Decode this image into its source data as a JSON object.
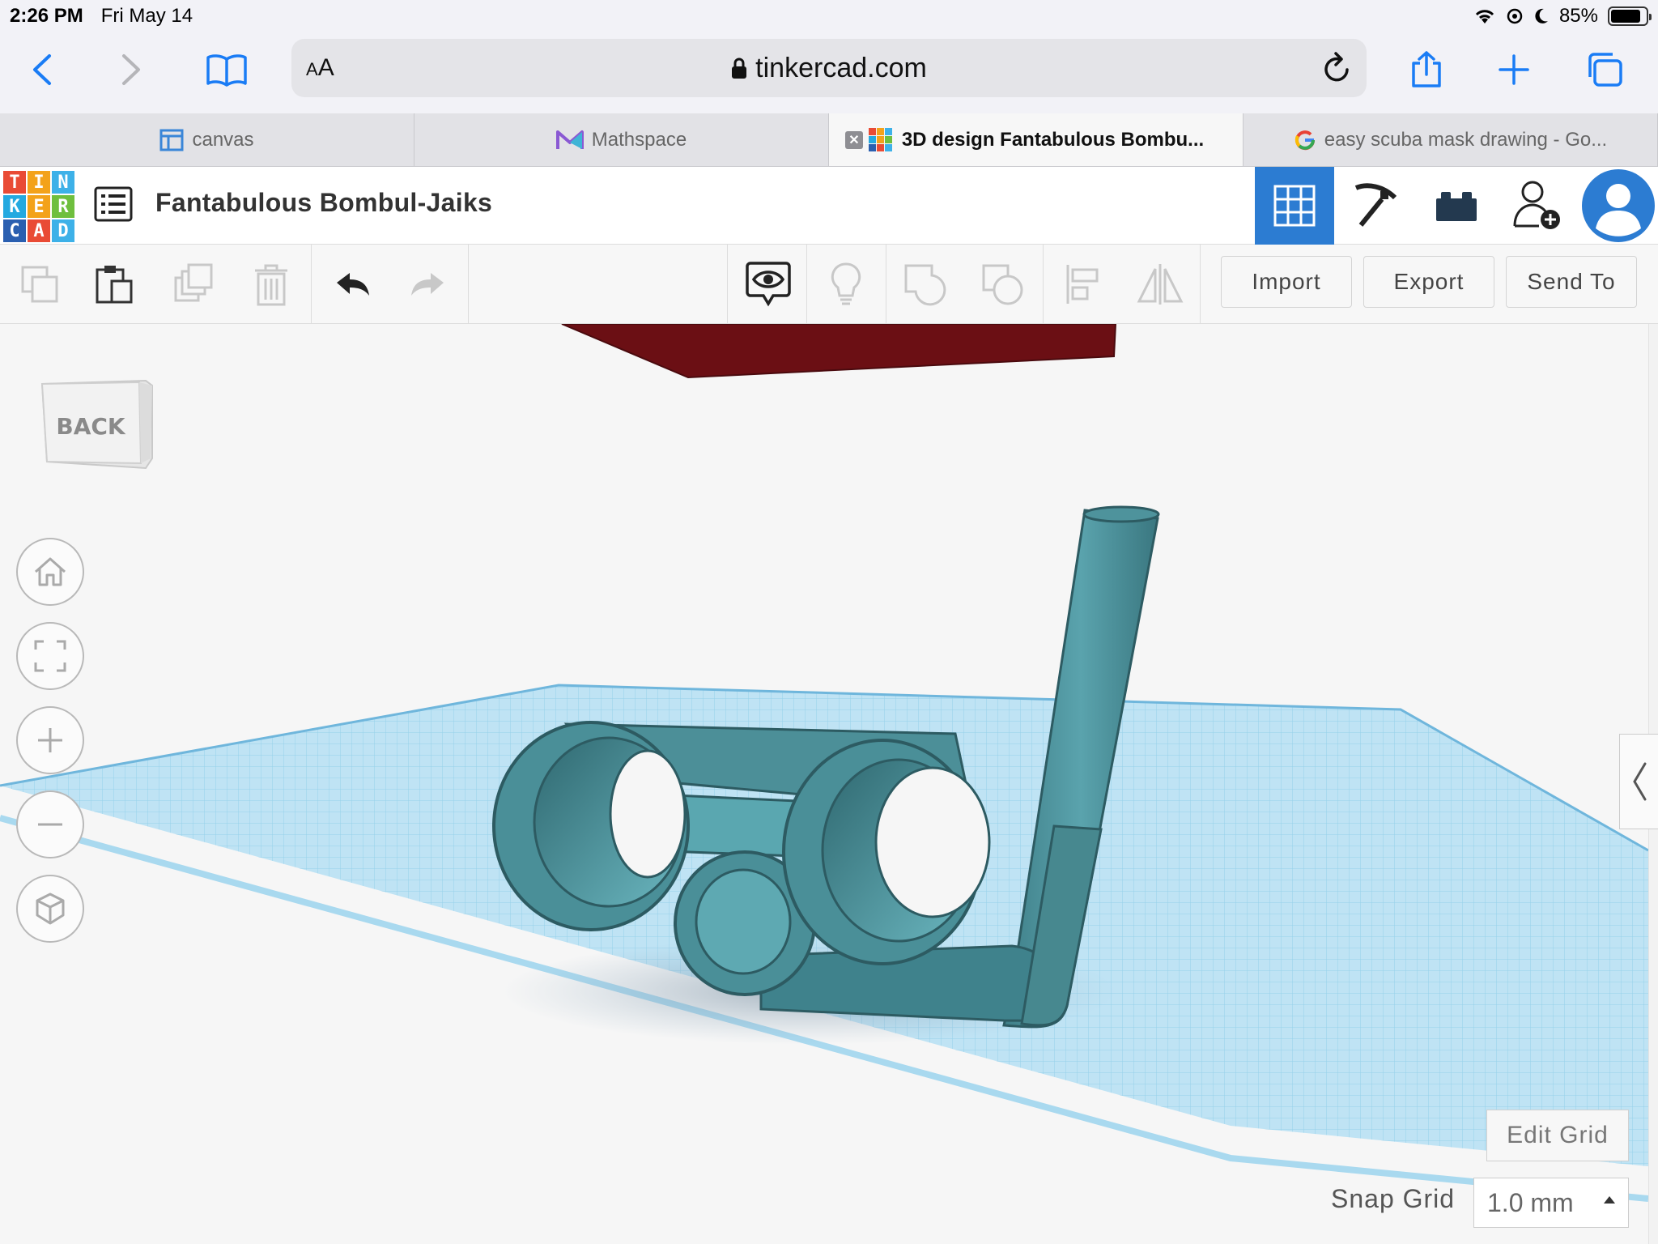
{
  "status": {
    "time": "2:26 PM",
    "date": "Fri May 14",
    "battery": "85%",
    "battery_level": 0.85
  },
  "browser": {
    "text_size_label_small": "A",
    "text_size_label_large": "A",
    "url": "tinkercad.com",
    "icons": [
      "back-icon",
      "forward-icon",
      "bookmarks-icon",
      "lock-icon",
      "reload-icon",
      "share-icon",
      "new-tab-icon",
      "tabs-overview-icon"
    ]
  },
  "tabs": [
    {
      "label": "canvas"
    },
    {
      "label": "Mathspace"
    },
    {
      "label": "3D design Fantabulous Bombu..."
    },
    {
      "label": "easy scuba mask drawing - Go..."
    }
  ],
  "tinkercad": {
    "logo": [
      "T",
      "I",
      "N",
      "K",
      "E",
      "R",
      "C",
      "A",
      "D"
    ],
    "logo_colors": [
      "#e94b35",
      "#f3a21a",
      "#3db1e8",
      "#24a9e0",
      "#f3a21a",
      "#6fbf3e",
      "#2a5fb0",
      "#e94b35",
      "#3db1e8"
    ],
    "design_name": "Fantabulous Bombul-Jaiks",
    "accent_color": "#2c7cd2"
  },
  "editor": {
    "import_label": "Import",
    "export_label": "Export",
    "send_to_label": "Send To"
  },
  "viewport": {
    "view_cube_face": "BACK",
    "edit_grid_label": "Edit Grid",
    "snap_grid_label": "Snap Grid",
    "snap_grid_value": "1.0 mm",
    "shape_color": "#4a8f98",
    "red_shape_color": "#6b0f14",
    "workplane_color": "#bfe3f4"
  }
}
